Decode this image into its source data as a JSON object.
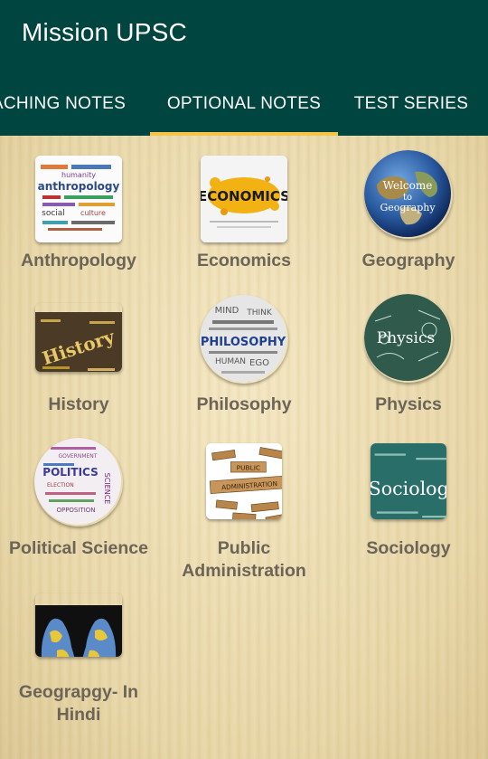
{
  "app": {
    "title": "Mission UPSC"
  },
  "tabs": [
    {
      "label": "ACHING NOTES"
    },
    {
      "label": "OPTIONAL NOTES"
    },
    {
      "label": "TEST SERIES"
    }
  ],
  "active_tab": "OPTIONAL NOTES",
  "colors": {
    "appbar": "#00453f",
    "indicator": "#f7c44a",
    "label": "#6b6457"
  },
  "subjects": [
    {
      "label": "Anthropology",
      "icon": "anthropology-wordcloud-icon",
      "icon_text": [
        "anthropology",
        "humanity",
        "social",
        "culture"
      ]
    },
    {
      "label": "Economics",
      "icon": "economics-splash-icon",
      "icon_text": [
        "ECONOMICS"
      ]
    },
    {
      "label": "Geography",
      "icon": "globe-icon",
      "icon_text": [
        "Welcome",
        "to",
        "Geography"
      ]
    },
    {
      "label": "History",
      "icon": "history-wordcloud-icon",
      "icon_text": [
        "History"
      ]
    },
    {
      "label": "Philosophy",
      "icon": "philosophy-wordcloud-icon",
      "icon_text": [
        "PHILOSOPHY",
        "MIND",
        "THINK",
        "HUMAN",
        "EGO"
      ]
    },
    {
      "label": "Physics",
      "icon": "physics-chalkboard-icon",
      "icon_text": [
        "Physics"
      ]
    },
    {
      "label": "Political Science",
      "icon": "politics-wordcloud-icon",
      "icon_text": [
        "POLITICS",
        "SCIENCE",
        "GOVERNMENT",
        "ELECTION",
        "OPPOSITION"
      ]
    },
    {
      "label": "Public Administration",
      "icon": "public-administration-blocks-icon",
      "icon_text": [
        "PUBLIC",
        "ADMINISTRATION"
      ]
    },
    {
      "label": "Sociology",
      "icon": "sociology-board-icon",
      "icon_text": [
        "Sociology"
      ]
    },
    {
      "label": "Geograpgy- In Hindi",
      "icon": "hands-world-map-icon",
      "icon_text": []
    }
  ]
}
